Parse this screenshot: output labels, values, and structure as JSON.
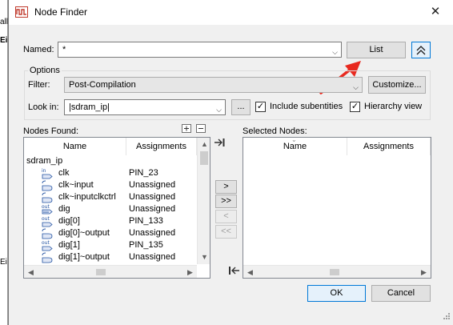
{
  "background_app": {
    "fragments": [
      "all",
      "Ei",
      "Ei"
    ]
  },
  "window": {
    "title": "Node Finder"
  },
  "named": {
    "label": "Named:",
    "value": "*"
  },
  "list_button": "List",
  "options": {
    "group_label": "Options",
    "filter_label": "Filter:",
    "filter_value": "Post-Compilation",
    "customize_button": "Customize...",
    "lookin_label": "Look in:",
    "lookin_value": "|sdram_ip|",
    "browse_button": "...",
    "include_subentities_label": "Include subentities",
    "include_subentities_checked": true,
    "hierarchy_view_label": "Hierarchy view",
    "hierarchy_view_checked": true
  },
  "nodes_found": {
    "label": "Nodes Found:",
    "columns": [
      "Name",
      "Assignments"
    ],
    "root": "sdram_ip",
    "rows": [
      {
        "name": "clk",
        "assignment": "PIN_23",
        "icon": "input-pin-icon"
      },
      {
        "name": "clk~input",
        "assignment": "Unassigned",
        "icon": "combinational-node-icon"
      },
      {
        "name": "clk~inputclkctrl",
        "assignment": "Unassigned",
        "icon": "combinational-node-icon"
      },
      {
        "name": "dig",
        "assignment": "Unassigned",
        "icon": "output-bus-icon"
      },
      {
        "name": "dig[0]",
        "assignment": "PIN_133",
        "icon": "output-pin-icon"
      },
      {
        "name": "dig[0]~output",
        "assignment": "Unassigned",
        "icon": "combinational-node-icon"
      },
      {
        "name": "dig[1]",
        "assignment": "PIN_135",
        "icon": "output-pin-icon"
      },
      {
        "name": "dig[1]~output",
        "assignment": "Unassigned",
        "icon": "combinational-node-icon"
      }
    ]
  },
  "transfer_buttons": {
    "add": ">",
    "add_all": ">>",
    "remove": "<",
    "remove_all": "<<"
  },
  "selected_nodes": {
    "label": "Selected Nodes:",
    "columns": [
      "Name",
      "Assignments"
    ]
  },
  "footer": {
    "ok_button": "OK",
    "cancel_button": "Cancel"
  },
  "colors": {
    "annotation_arrow": "#e8291f",
    "focus_blue": "#0078d7",
    "window_bg": "#f0f0f0"
  }
}
